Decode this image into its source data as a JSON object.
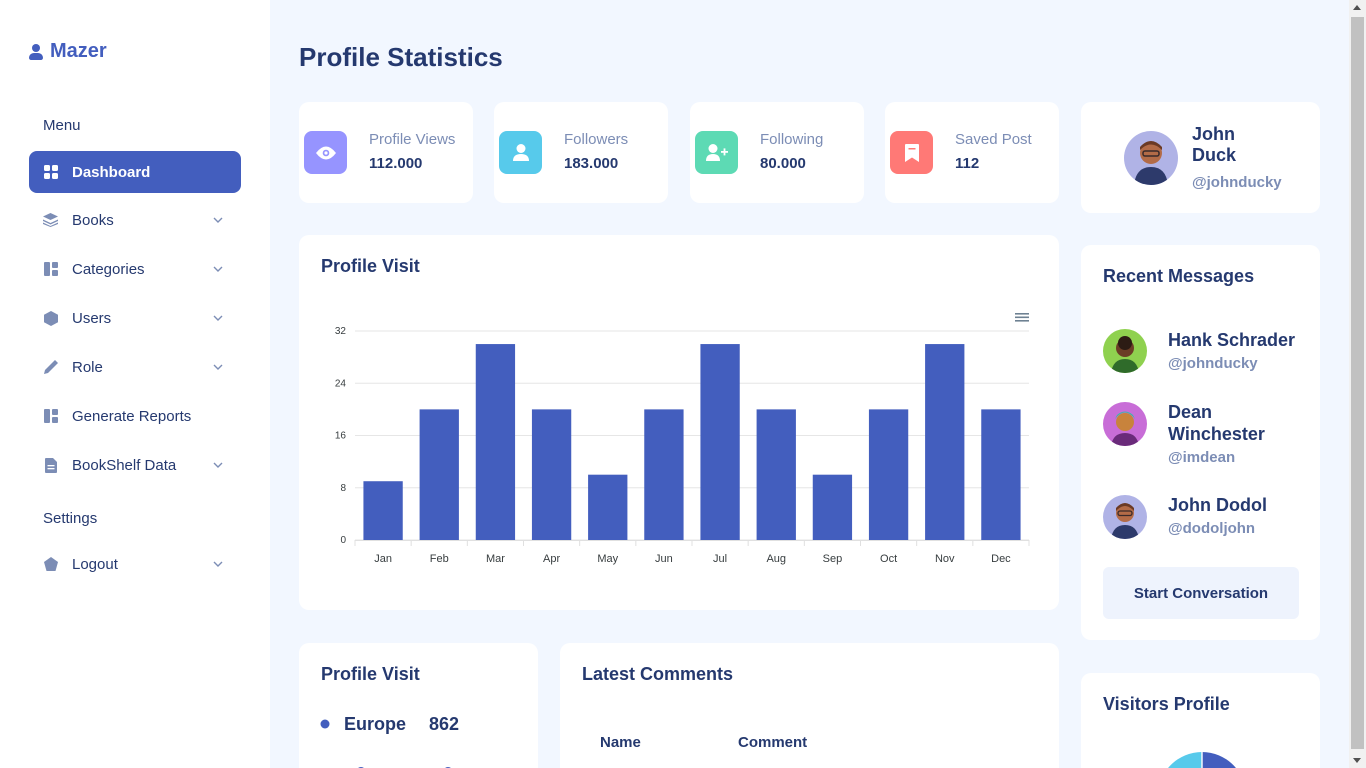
{
  "brand": {
    "name": "Mazer",
    "icon": "person-icon"
  },
  "sidebar": {
    "menu_title": "Menu",
    "settings_title": "Settings",
    "items": [
      {
        "label": "Dashboard",
        "icon": "grid-icon",
        "active": true,
        "has_submenu": false
      },
      {
        "label": "Books",
        "icon": "stack-icon",
        "active": false,
        "has_submenu": true
      },
      {
        "label": "Categories",
        "icon": "layout-icon",
        "active": false,
        "has_submenu": true
      },
      {
        "label": "Users",
        "icon": "hexagon-icon",
        "active": false,
        "has_submenu": true
      },
      {
        "label": "Role",
        "icon": "pen-icon",
        "active": false,
        "has_submenu": true
      },
      {
        "label": "Generate Reports",
        "icon": "layout-icon",
        "active": false,
        "has_submenu": false
      },
      {
        "label": "BookShelf Data",
        "icon": "file-icon",
        "active": false,
        "has_submenu": true
      }
    ],
    "logout": {
      "label": "Logout",
      "icon": "pentagon-icon",
      "has_submenu": true
    }
  },
  "page": {
    "title": "Profile Statistics"
  },
  "stats": [
    {
      "label": "Profile Views",
      "value": "112.000",
      "icon": "eye-icon",
      "color": "#9694ff"
    },
    {
      "label": "Followers",
      "value": "183.000",
      "icon": "user-icon",
      "color": "#57caeb"
    },
    {
      "label": "Following",
      "value": "80.000",
      "icon": "user-plus-icon",
      "color": "#5ddab4"
    },
    {
      "label": "Saved Post",
      "value": "112",
      "icon": "bookmark-icon",
      "color": "#ff7976"
    }
  ],
  "profile": {
    "first": "John",
    "last": "Duck",
    "handle": "@johnducky"
  },
  "visit_chart": {
    "title": "Profile Visit",
    "menu_icon": "hamburger-icon"
  },
  "chart_data": {
    "type": "bar",
    "title": "Profile Visit",
    "categories": [
      "Jan",
      "Feb",
      "Mar",
      "Apr",
      "May",
      "Jun",
      "Jul",
      "Aug",
      "Sep",
      "Oct",
      "Nov",
      "Dec"
    ],
    "values": [
      9,
      20,
      30,
      20,
      10,
      20,
      30,
      20,
      10,
      20,
      30,
      20
    ],
    "yticks": [
      "0",
      "8",
      "16",
      "24",
      "32"
    ],
    "ylim": [
      0,
      32
    ],
    "color": "#435ebe",
    "grid": true
  },
  "messages": {
    "title": "Recent Messages",
    "items": [
      {
        "name": "Hank Schrader",
        "handle": "@johnducky",
        "color": "#8fd14f"
      },
      {
        "name": "Dean Winchester",
        "handle": "@imdean",
        "color": "#c86dd7"
      },
      {
        "name": "John Dodol",
        "handle": "@dodoljohn",
        "color": "#b0b3e6"
      }
    ],
    "button": "Start Conversation"
  },
  "region_card": {
    "title": "Profile Visit",
    "items": [
      {
        "region": "Europe",
        "value": "862",
        "color": "#435ebe"
      }
    ]
  },
  "comments": {
    "title": "Latest Comments",
    "headers": [
      "Name",
      "Comment"
    ]
  },
  "visitors": {
    "title": "Visitors Profile"
  }
}
